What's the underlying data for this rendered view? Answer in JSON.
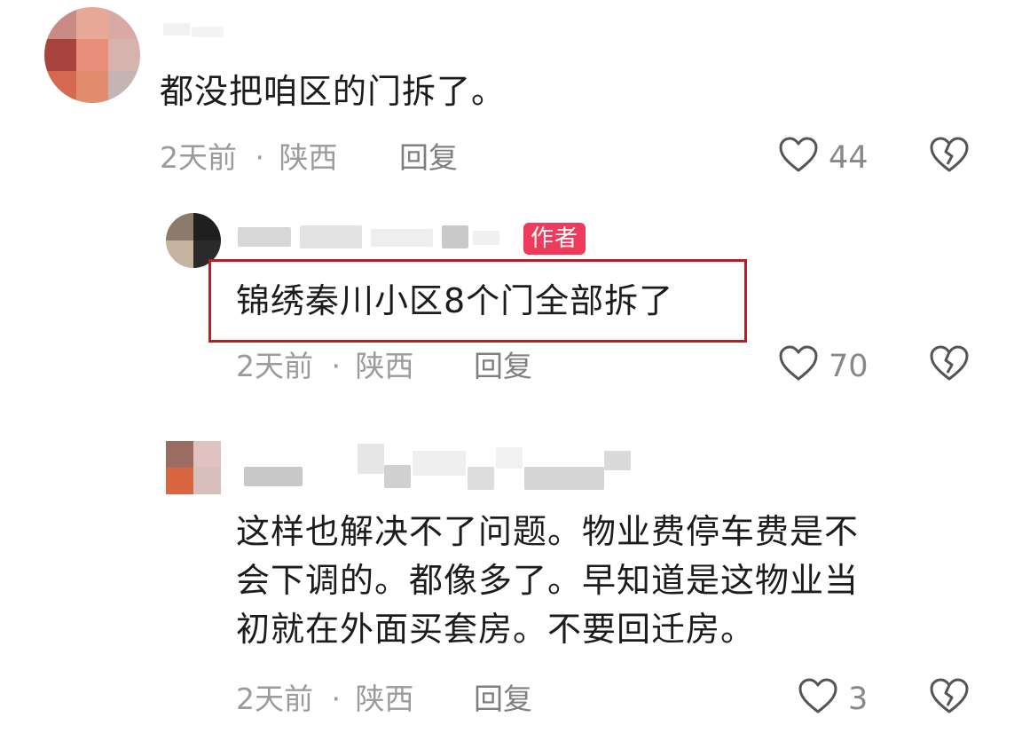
{
  "comments": [
    {
      "text": "都没把咱区的门拆了。",
      "time": "2天前",
      "separator": "·",
      "location": "陕西",
      "reply_label": "回复",
      "likes": "44"
    },
    {
      "badge": "作者",
      "text": "锦绣秦川小区8个门全部拆了",
      "time": "2天前",
      "separator": "·",
      "location": "陕西",
      "reply_label": "回复",
      "likes": "70"
    },
    {
      "text_lines": [
        "这样也解决不了问题。物业费停车费是不",
        "会下调的。都像多了。早知道是这物业当",
        "初就在外面买套房。不要回迁房。"
      ],
      "time": "2天前",
      "separator": "·",
      "location": "陕西",
      "reply_label": "回复",
      "likes": "3"
    }
  ],
  "icons": {
    "like": "heart-outline-icon",
    "dislike": "broken-heart-icon"
  },
  "colors": {
    "badge": "#ee3b5b",
    "highlight": "#b81f24",
    "meta": "#9b9b9b"
  }
}
